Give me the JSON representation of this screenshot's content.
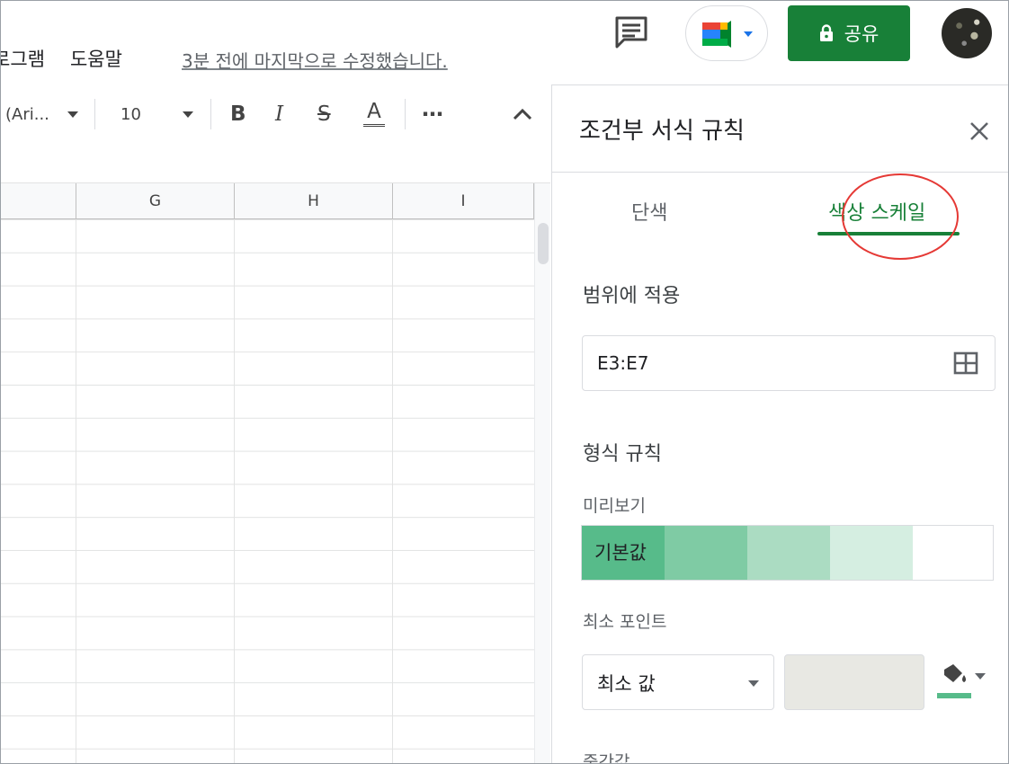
{
  "header": {
    "menu_items": [
      "로그램",
      "도움말"
    ],
    "last_edit": "3분 전에 마지막으로 수정했습니다.",
    "share_label": "공유"
  },
  "toolbar": {
    "font_name": "(Ari...",
    "font_size": "10",
    "bold": "B",
    "italic": "I",
    "strike": "S",
    "text_color": "A",
    "more": "⋯"
  },
  "grid": {
    "columns": [
      "G",
      "H",
      "I"
    ]
  },
  "panel": {
    "title": "조건부 서식 규칙",
    "tabs": [
      "단색",
      "색상 스케일"
    ],
    "active_tab": "색상 스케일",
    "apply_range_label": "범위에 적용",
    "range_value": "E3:E7",
    "format_rules_label": "형식 규칙",
    "preview_label": "미리보기",
    "preview_text": "기본값",
    "preview_colors": [
      "#57bb8a",
      "#7fcba4",
      "#abdcc2",
      "#d5eee1",
      "#ffffff"
    ],
    "min_point_label": "최소 포인트",
    "min_point_value": "최소 값",
    "midpoint_label": "중간값",
    "min_color": "#57bb8a"
  }
}
